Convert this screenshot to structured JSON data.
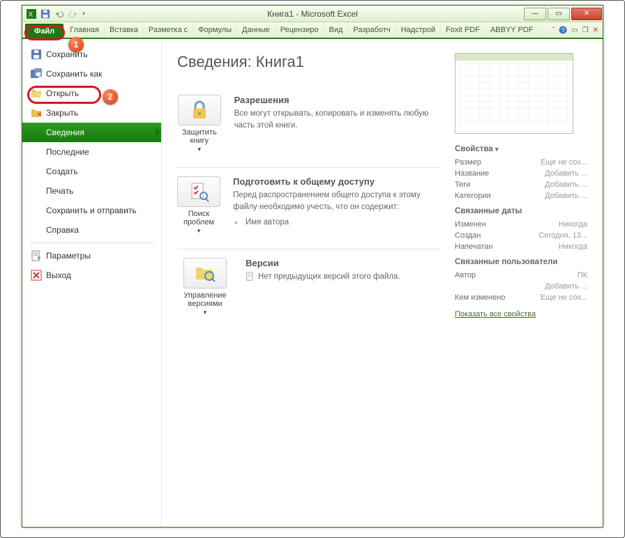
{
  "window": {
    "title": "Книга1  -  Microsoft Excel"
  },
  "ribbon": {
    "file": "Файл",
    "tabs": [
      "Главная",
      "Вставка",
      "Разметка с",
      "Формулы",
      "Данные",
      "Рецензиро",
      "Вид",
      "Разработч",
      "Надстрой",
      "Foxit PDF",
      "ABBYY PDF"
    ]
  },
  "sidebar": {
    "save": "Сохранить",
    "saveas": "Сохранить как",
    "open": "Открыть",
    "close": "Закрыть",
    "info": "Сведения",
    "recent": "Последние",
    "new": "Создать",
    "print": "Печать",
    "share": "Сохранить и отправить",
    "help": "Справка",
    "options": "Параметры",
    "exit": "Выход"
  },
  "page": {
    "heading": "Сведения: Книга1",
    "perm": {
      "btn": "Защитить книгу",
      "title": "Разрешения",
      "text": "Все могут открывать, копировать и изменять любую часть этой книги."
    },
    "share": {
      "btn": "Поиск проблем",
      "title": "Подготовить к общему доступу",
      "text": "Перед распространением общего доступа к этому файлу необходимо учесть, что он содержит:",
      "item": "Имя автора"
    },
    "ver": {
      "btn": "Управление версиями",
      "title": "Версии",
      "text": "Нет предыдущих версий этого файла."
    }
  },
  "props": {
    "header": "Свойства",
    "size_k": "Размер",
    "size_v": "Еще не сох...",
    "title_k": "Название",
    "title_v": "Добавить ...",
    "tags_k": "Теги",
    "tags_v": "Добавить ...",
    "cat_k": "Категории",
    "cat_v": "Добавить ...",
    "dates_h": "Связанные даты",
    "mod_k": "Изменен",
    "mod_v": "Никогда",
    "cre_k": "Создан",
    "cre_v": "Сегодня, 13...",
    "prn_k": "Напечатан",
    "prn_v": "Никогда",
    "users_h": "Связанные пользователи",
    "auth_k": "Автор",
    "auth_v": "ПК",
    "auth_add": "Добавить ...",
    "last_k": "Кем изменено",
    "last_v": "Еще не сох...",
    "all": "Показать все свойства"
  }
}
